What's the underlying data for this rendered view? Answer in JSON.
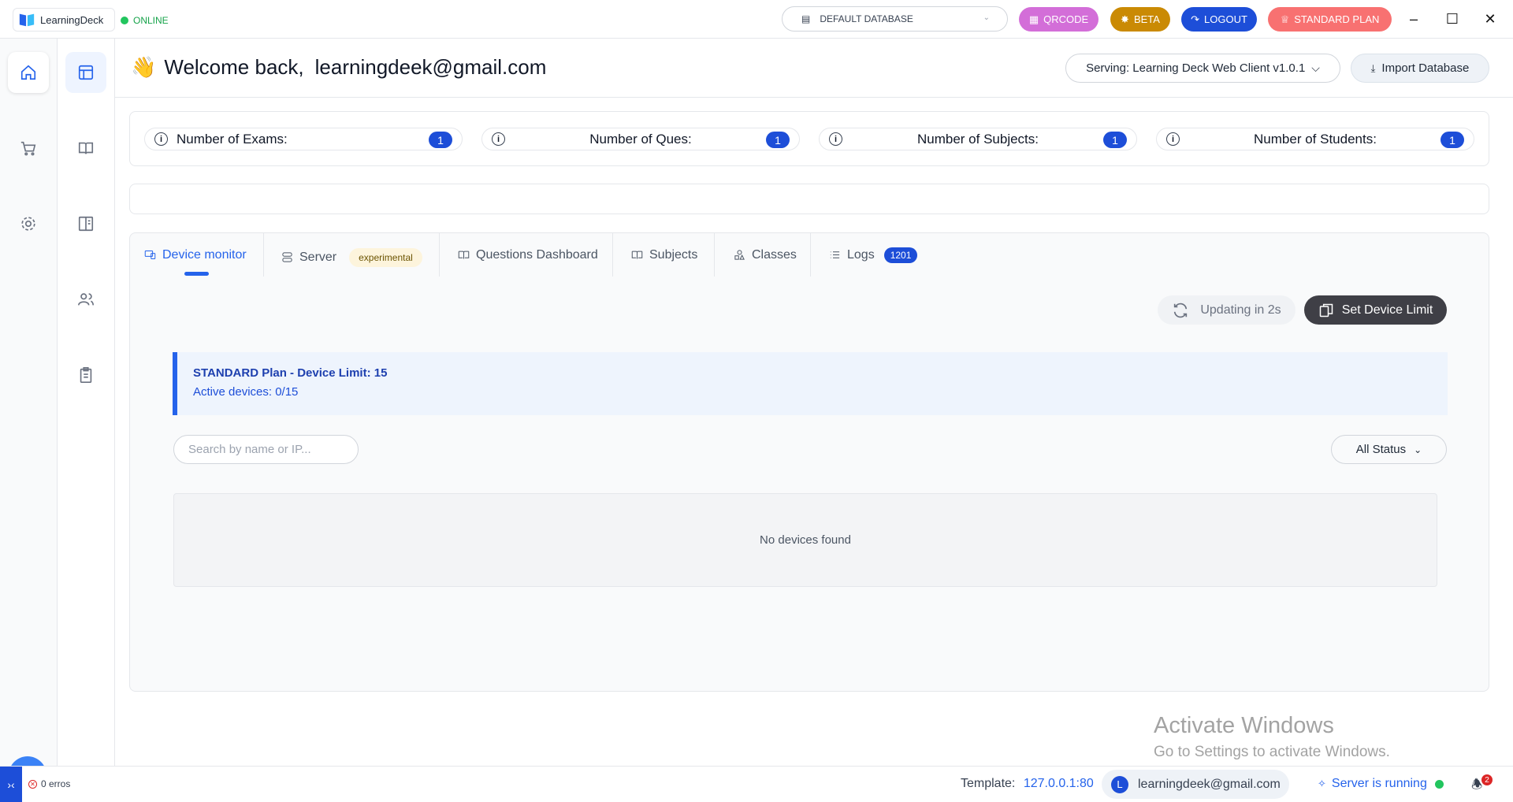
{
  "titlebar": {
    "app_name": "LearningDeck",
    "connection_status": "ONLINE",
    "database_select": "DEFAULT DATABASE",
    "buttons": {
      "qrcode": "QRCODE",
      "beta": "BETA",
      "logout": "LOGOUT",
      "plan": "STANDARD PLAN"
    },
    "colors": {
      "qrcode": "#d36ed8",
      "beta": "#ca8a04",
      "logout": "#1d4ed8",
      "plan": "#f87171"
    }
  },
  "sidebar": {
    "primary": [
      "home-icon",
      "cart-icon",
      "gear-icon"
    ],
    "secondary": [
      "dashboard-icon",
      "book-icon",
      "panel-icon",
      "users-icon",
      "clipboard-icon"
    ]
  },
  "header": {
    "welcome_text": "Welcome back,",
    "user_email": "learningdeek@gmail.com",
    "serving_label": "Serving: Learning Deck Web Client v1.0.1",
    "import_label": "Import Database"
  },
  "stats": [
    {
      "label": "Number of Exams:",
      "count": "1"
    },
    {
      "label": "Number of Ques:",
      "count": "1"
    },
    {
      "label": "Number of Subjects:",
      "count": "1"
    },
    {
      "label": "Number of Students:",
      "count": "1"
    }
  ],
  "tabs": [
    {
      "label": "Device monitor",
      "active": true
    },
    {
      "label": "Server",
      "badge": "experimental"
    },
    {
      "label": "Questions Dashboard"
    },
    {
      "label": "Subjects"
    },
    {
      "label": "Classes"
    },
    {
      "label": "Logs",
      "badge": "1201"
    }
  ],
  "device_monitor": {
    "updating_label": "Updating in 2s",
    "set_limit_label": "Set Device Limit",
    "plan_title": "STANDARD Plan - Device Limit: 15",
    "active_devices": "Active devices: 0/15",
    "search_placeholder": "Search by name or IP...",
    "status_filter": "All Status",
    "empty_message": "No devices found"
  },
  "watermark": {
    "line1": "Activate Windows",
    "line2": "Go to Settings to activate Windows."
  },
  "statusbar": {
    "errors": "0 erros",
    "template_label": "Template:",
    "template_ip": "127.0.0.1:80",
    "user_initial": "L",
    "user_email": "learningdeek@gmail.com",
    "server_status": "Server is running",
    "notification_count": "2"
  }
}
